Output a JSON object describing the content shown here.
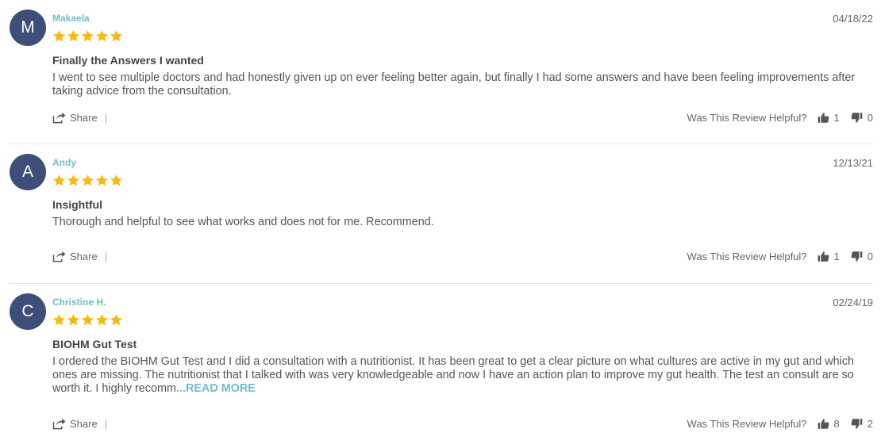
{
  "reviews": [
    {
      "initial": "M",
      "name": "Makaela",
      "date": "04/18/22",
      "stars": 5,
      "title": "Finally the Answers I wanted",
      "body": "I went to see multiple doctors and had honestly given up on ever feeling better again, but finally I had some answers and have been feeling improvements after taking advice from the consultation.",
      "read_more": "",
      "share_label": "Share",
      "separator": "|",
      "helpful_label": "Was This Review Helpful?",
      "upvotes": "1",
      "downvotes": "0"
    },
    {
      "initial": "A",
      "name": "Andy",
      "date": "12/13/21",
      "stars": 5,
      "title": "Insightful",
      "body": "Thorough and helpful to see what works and does not for me. Recommend.",
      "read_more": "",
      "share_label": "Share",
      "separator": "|",
      "helpful_label": "Was This Review Helpful?",
      "upvotes": "1",
      "downvotes": "0"
    },
    {
      "initial": "C",
      "name": "Christine H.",
      "date": "02/24/19",
      "stars": 5,
      "title": "BIOHM Gut Test",
      "body": "I ordered the BIOHM Gut Test and I did a consultation with a nutritionist. It has been great to get a clear picture on what cultures are active in my gut and which ones are missing. The nutritionist that I talked with was very knowledgeable and now I have an action plan to improve my gut health. The test an consult are so worth it. I highly recomm",
      "read_more": "...READ MORE",
      "share_label": "Share",
      "separator": "|",
      "helpful_label": "Was This Review Helpful?",
      "upvotes": "8",
      "downvotes": "2"
    }
  ],
  "colors": {
    "avatar": "#3d4e79",
    "reviewer_name": "#70bdc7",
    "star": "#f5b911",
    "read_more": "#70bdc7"
  },
  "icons": {
    "share": "share-icon",
    "star": "star-icon",
    "thumbs_up": "thumbs-up-icon",
    "thumbs_down": "thumbs-down-icon"
  }
}
